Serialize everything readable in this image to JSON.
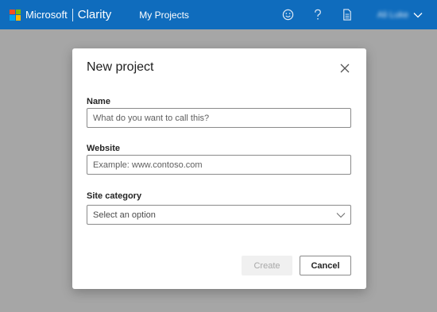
{
  "header": {
    "brand_company": "Microsoft",
    "brand_product": "Clarity",
    "nav_my_projects": "My Projects",
    "user_name": "Ali Luke",
    "icons": [
      "smiley-icon",
      "help-icon",
      "document-icon",
      "chevron-down-icon"
    ],
    "colors": {
      "bar": "#0f6cbd"
    }
  },
  "dialog": {
    "title": "New project",
    "name_label": "Name",
    "name_placeholder": "What do you want to call this?",
    "name_value": "",
    "website_label": "Website",
    "website_placeholder": "Example: www.contoso.com",
    "website_value": "",
    "category_label": "Site category",
    "category_selected": "Select an option",
    "create_label": "Create",
    "cancel_label": "Cancel"
  }
}
